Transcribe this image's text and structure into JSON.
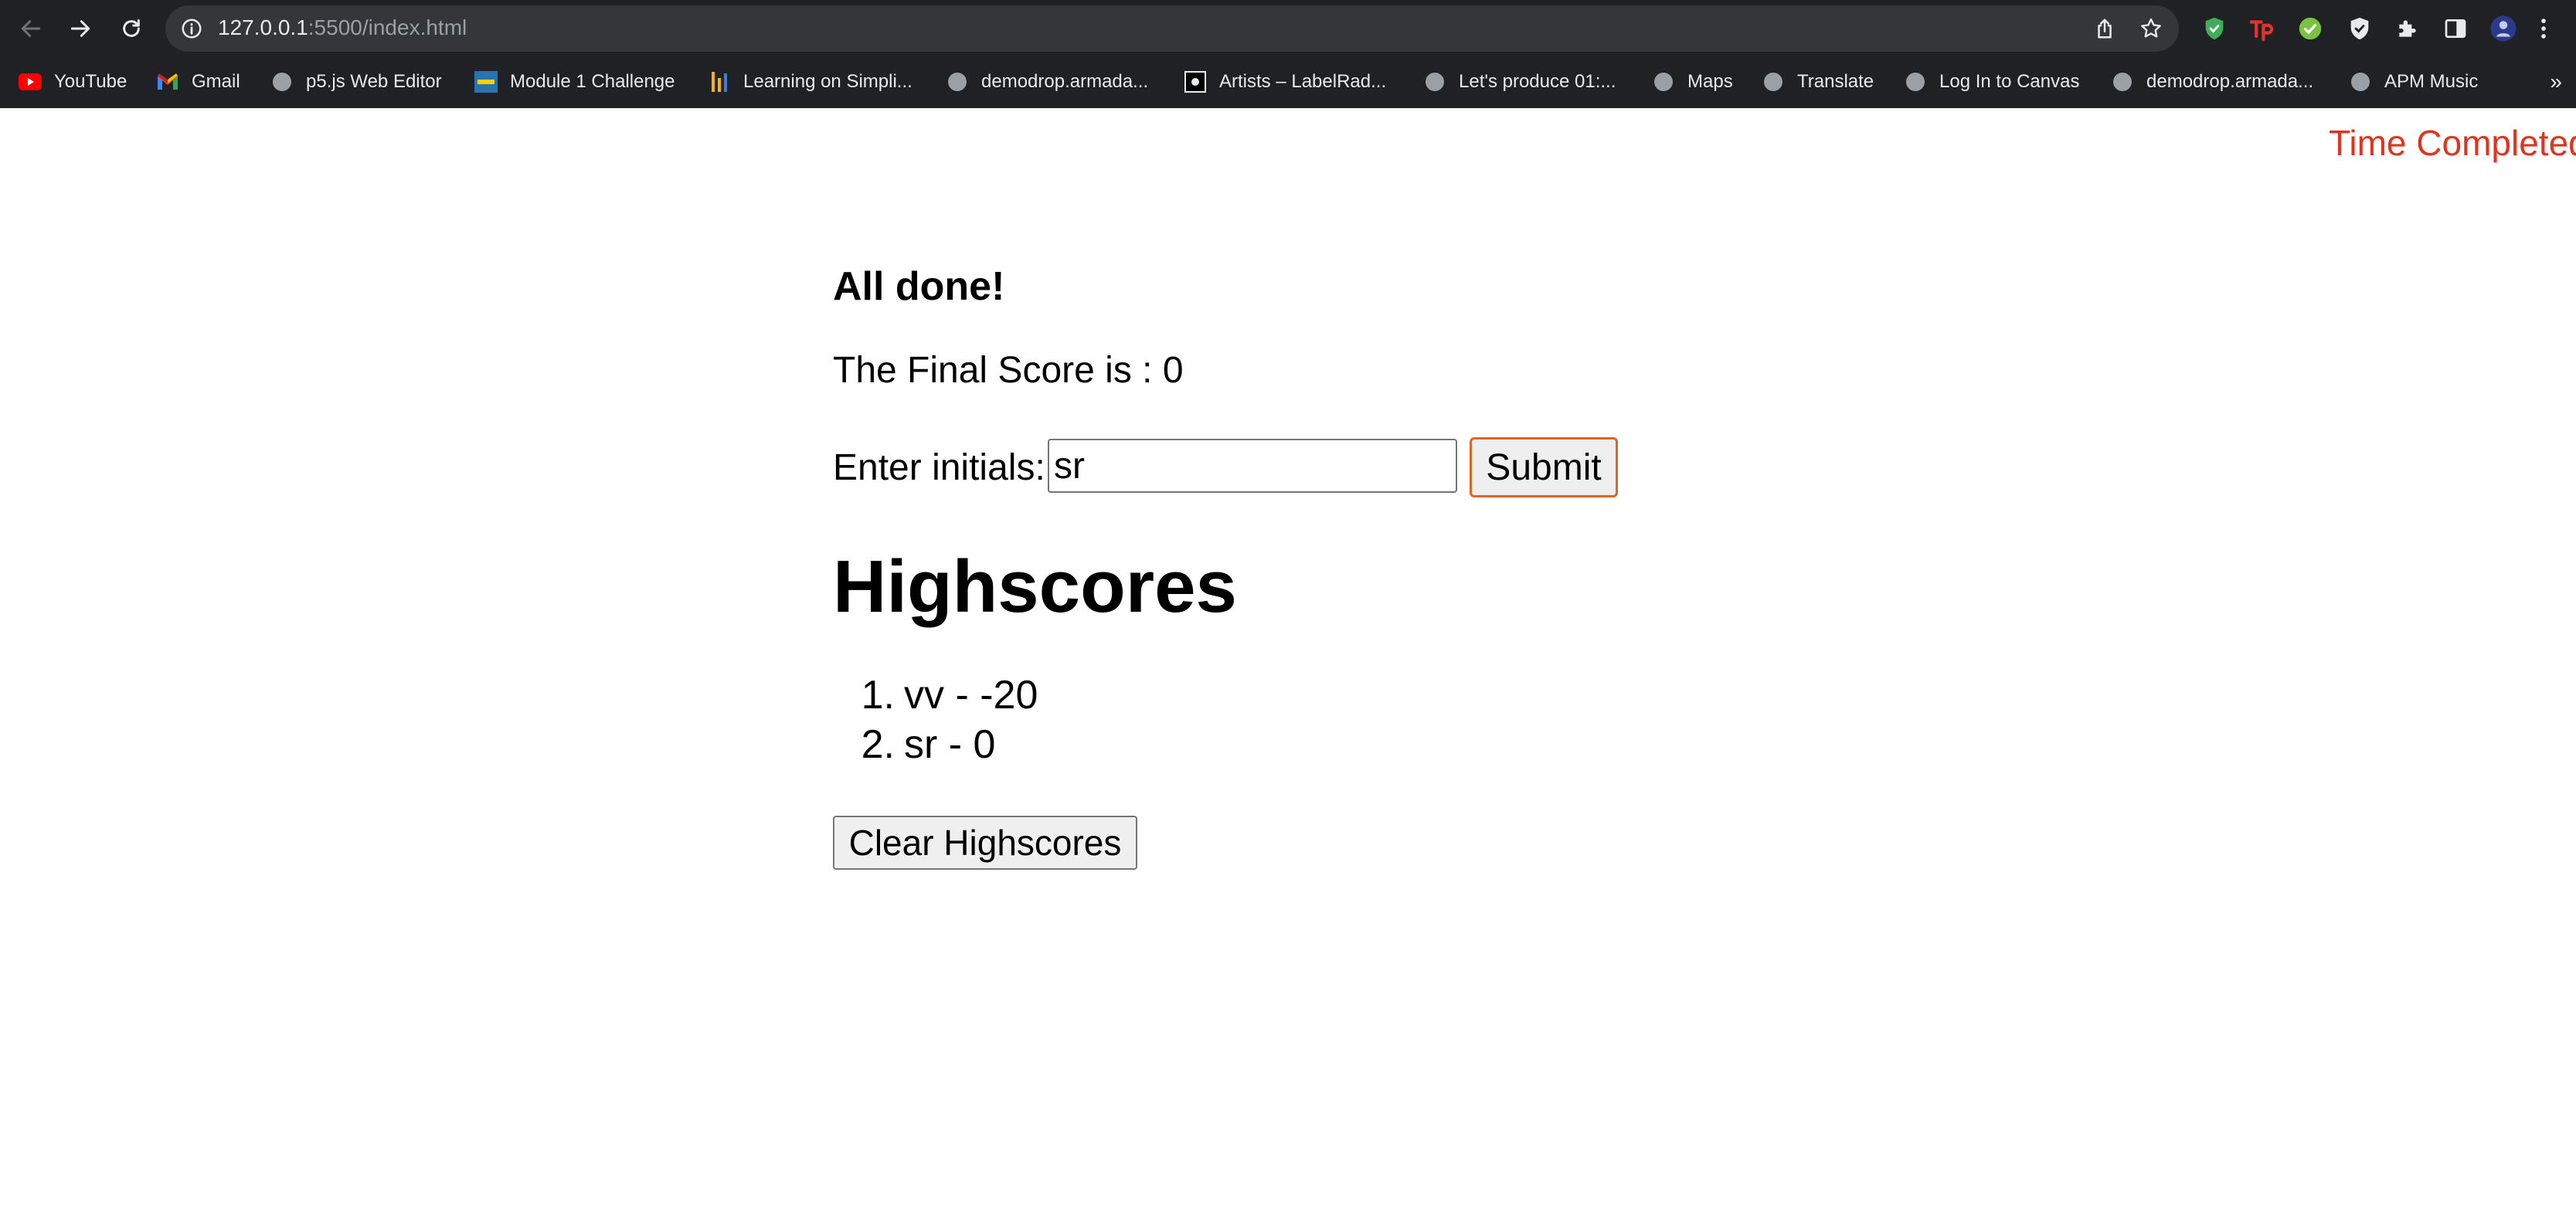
{
  "browser": {
    "url_host": "127.0.0.1",
    "url_rest": ":5500/index.html",
    "icons": {
      "back": "arrow-left-icon",
      "forward": "arrow-right-icon",
      "reload": "reload-icon",
      "info": "info-icon",
      "share": "share-icon",
      "bookmark": "star-icon",
      "extensions": [
        "shield-extension-icon",
        "tp-extension-icon",
        "check-extension-icon",
        "adblock-shield-icon",
        "puzzle-icon",
        "side-panel-icon",
        "profile-avatar-icon",
        "more-menu-icon"
      ]
    },
    "bookmarks": [
      {
        "label": "YouTube",
        "icon": "youtube-icon"
      },
      {
        "label": "Gmail",
        "icon": "gmail-icon"
      },
      {
        "label": "p5.js Web Editor",
        "icon": "globe-icon"
      },
      {
        "label": "Module 1 Challenge",
        "icon": "ucla-icon"
      },
      {
        "label": "Learning on Simpli...",
        "icon": "bars-icon"
      },
      {
        "label": "demodrop.armada...",
        "icon": "globe-icon"
      },
      {
        "label": "Artists – LabelRad...",
        "icon": "labelradar-icon"
      },
      {
        "label": "Let's produce 01:...",
        "icon": "globe-icon"
      },
      {
        "label": "Maps",
        "icon": "globe-icon"
      },
      {
        "label": "Translate",
        "icon": "globe-icon"
      },
      {
        "label": "Log In to Canvas",
        "icon": "globe-icon"
      },
      {
        "label": "demodrop.armada...",
        "icon": "globe-icon"
      },
      {
        "label": "APM Music",
        "icon": "globe-icon"
      }
    ],
    "more_label": "»"
  },
  "colors": {
    "chrome_bg": "#202124",
    "timer_red": "#e0341e",
    "submit_border": "#e0651f"
  },
  "page": {
    "timer_text": "Time Completed",
    "done_title": "All done!",
    "final_score_label": "The Final Score is : ",
    "final_score_value": "0",
    "initials_label": "Enter initials:",
    "initials_value": "sr",
    "submit_label": "Submit",
    "highscores_title": "Highscores",
    "highscores": [
      {
        "rank": "1.",
        "entry": "vv - -20"
      },
      {
        "rank": "2.",
        "entry": "sr - 0"
      }
    ],
    "clear_label": "Clear Highscores"
  }
}
